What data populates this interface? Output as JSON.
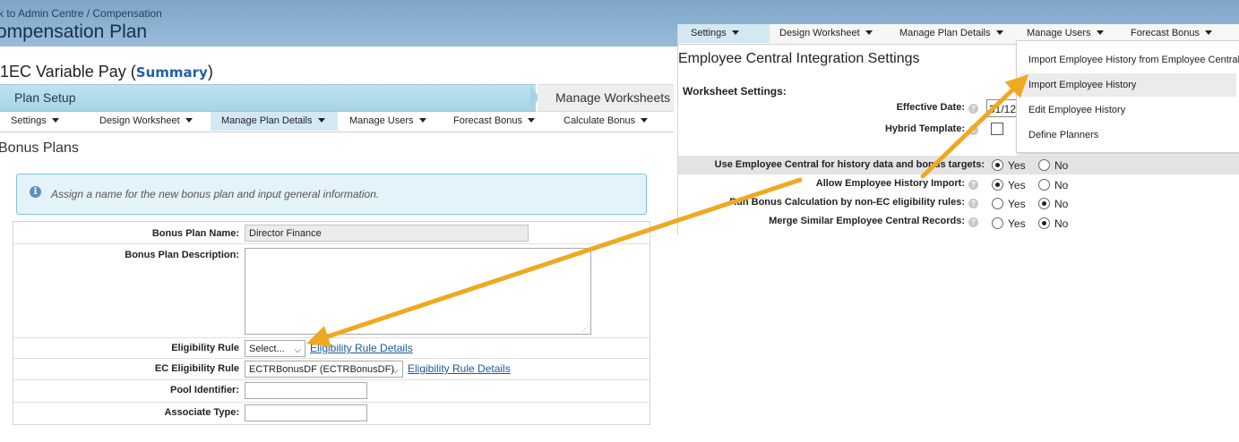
{
  "header": {
    "breadcrumb": "k to Admin Centre / Compensation",
    "title": "ompensation Plan"
  },
  "plan": {
    "name": "1EC Variable Pay",
    "summary_link": "Summary",
    "paren_open": "(",
    "paren_close": ")"
  },
  "progress": {
    "step_current": "Plan Setup",
    "step_next": "Manage Worksheets"
  },
  "left_menu": {
    "items": [
      "Settings",
      "Design Worksheet",
      "Manage Plan Details",
      "Manage Users",
      "Forecast Bonus",
      "Calculate Bonus"
    ],
    "active": "Manage Plan Details"
  },
  "bonus": {
    "section_title": "Bonus Plans",
    "info_text": "Assign a name for the new bonus plan and input general information.",
    "fields": {
      "name_label": "Bonus Plan Name:",
      "name_value": "Director Finance",
      "desc_label": "Bonus Plan Description:",
      "elig_label": "Eligibility Rule",
      "elig_value": "Select...",
      "elig_link": "Eligibility Rule Details",
      "ec_elig_label": "EC Eligibility Rule",
      "ec_elig_value": "ECTRBonusDF (ECTRBonusDF)",
      "ec_elig_link": "Eligibility Rule Details",
      "pool_label": "Pool Identifier:",
      "assoc_label": "Associate Type:"
    }
  },
  "right_menu": {
    "items": [
      "Settings",
      "Design Worksheet",
      "Manage Plan Details",
      "Manage Users",
      "Forecast Bonus"
    ],
    "active": "Settings"
  },
  "ec_settings": {
    "title": "Employee Central Integration Settings",
    "worksheet_heading": "Worksheet Settings:",
    "effective_date_label": "Effective Date:",
    "effective_date_value": "31/12",
    "hybrid_label": "Hybrid Template:",
    "rows": [
      {
        "label": "Use Employee Central for history data and bonus targets:",
        "selected": "yes"
      },
      {
        "label": "Allow Employee History Import:",
        "selected": "yes"
      },
      {
        "label": "Run Bonus Calculation by non-EC eligibility rules:",
        "selected": "no"
      },
      {
        "label": "Merge Similar Employee Central Records:",
        "selected": "no"
      }
    ],
    "yes_label": "Yes",
    "no_label": "No"
  },
  "dropdown": {
    "items": [
      "Import Employee History from Employee Central",
      "Import Employee History",
      "Edit Employee History",
      "Define Planners"
    ],
    "highlighted": "Import Employee History"
  },
  "colors": {
    "arrow": "#f0a820",
    "link": "#1a5a9a",
    "banner": "#8db2d2",
    "active_tab": "#d4e8f4"
  }
}
